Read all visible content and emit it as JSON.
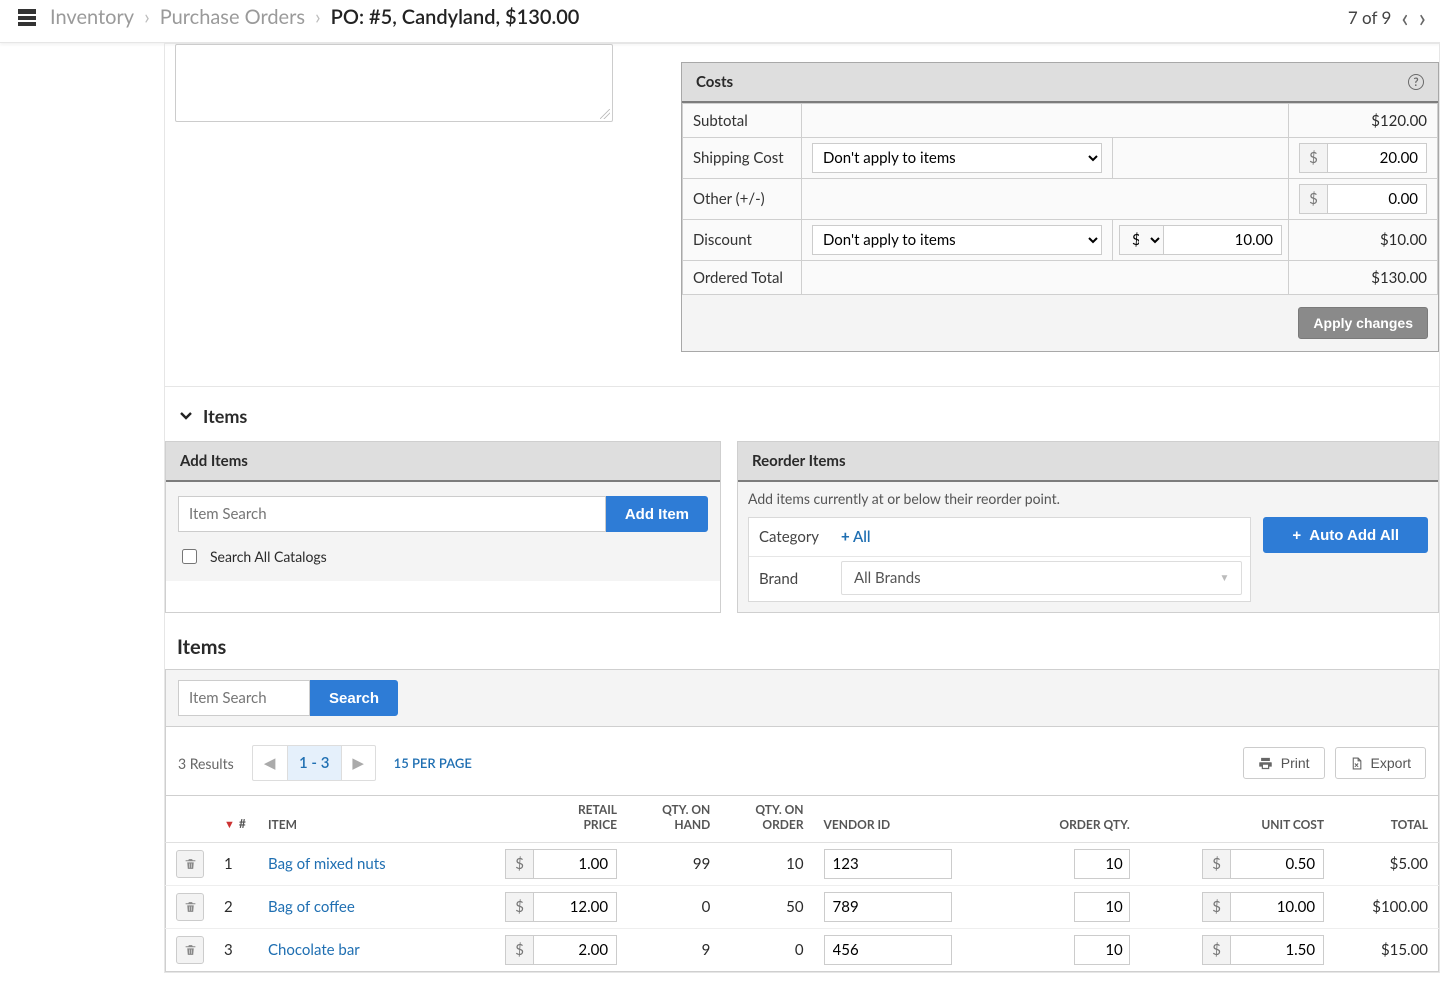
{
  "breadcrumb": {
    "root": "Inventory",
    "mid": "Purchase Orders",
    "current": "PO:  #5, Candyland, $130.00"
  },
  "pager": {
    "text": "7 of 9"
  },
  "costs": {
    "title": "Costs",
    "rows": {
      "subtotal_label": "Subtotal",
      "subtotal_amount": "$120.00",
      "shipping_label": "Shipping Cost",
      "shipping_select": "Don't apply to items",
      "shipping_value": "20.00",
      "other_label": "Other (+/-)",
      "other_value": "0.00",
      "discount_label": "Discount",
      "discount_select": "Don't apply to items",
      "discount_unit": "$",
      "discount_value": "10.00",
      "discount_amount": "$10.00",
      "total_label": "Ordered Total",
      "total_amount": "$130.00"
    },
    "apply_btn": "Apply changes"
  },
  "items_section": {
    "title": "Items"
  },
  "add_items": {
    "title": "Add Items",
    "placeholder": "Item Search",
    "button": "Add Item",
    "checkbox": "Search All Catalogs"
  },
  "reorder": {
    "title": "Reorder Items",
    "desc": "Add items currently at or below their reorder point.",
    "category_label": "Category",
    "category_value": "All",
    "brand_label": "Brand",
    "brand_value": "All Brands",
    "auto_btn": "Auto Add All"
  },
  "items_list": {
    "title": "Items",
    "search_placeholder": "Item Search",
    "search_btn": "Search",
    "results": "3 Results",
    "page_range": "1 - 3",
    "per_page": "15 PER PAGE",
    "print": "Print",
    "export": "Export",
    "cols": {
      "num": "#",
      "item": "ITEM",
      "retail1": "RETAIL",
      "retail2": "PRICE",
      "qoh1": "QTY. ON",
      "qoh2": "HAND",
      "qoo1": "QTY. ON",
      "qoo2": "ORDER",
      "vendor": "VENDOR ID",
      "order_qty": "ORDER QTY.",
      "unit_cost": "UNIT COST",
      "total": "TOTAL"
    },
    "rows": [
      {
        "n": "1",
        "name": "Bag of mixed nuts",
        "retail": "1.00",
        "on_hand": "99",
        "on_order": "10",
        "vendor": "123",
        "order_qty": "10",
        "unit_cost": "0.50",
        "total": "$5.00"
      },
      {
        "n": "2",
        "name": "Bag of coffee",
        "retail": "12.00",
        "on_hand": "0",
        "on_order": "50",
        "vendor": "789",
        "order_qty": "10",
        "unit_cost": "10.00",
        "total": "$100.00"
      },
      {
        "n": "3",
        "name": "Chocolate bar",
        "retail": "2.00",
        "on_hand": "9",
        "on_order": "0",
        "vendor": "456",
        "order_qty": "10",
        "unit_cost": "1.50",
        "total": "$15.00"
      }
    ]
  }
}
